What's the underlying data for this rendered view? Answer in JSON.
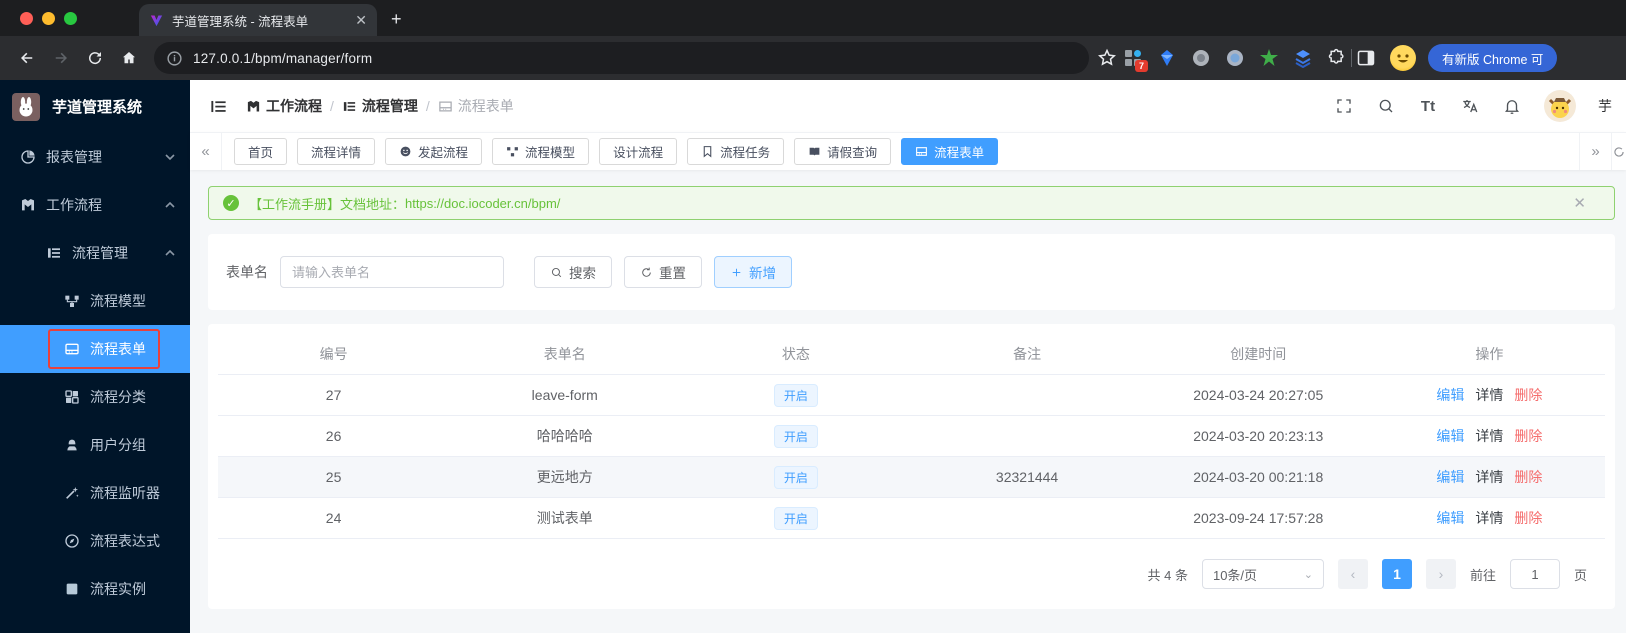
{
  "browser": {
    "tab_title": "芋道管理系统 - 流程表单",
    "url": "127.0.0.1/bpm/manager/form",
    "ext_badge": "7",
    "update_chip": "有新版 Chrome 可"
  },
  "sidebar": {
    "title": "芋道管理系统",
    "items": [
      {
        "label": "报表管理"
      },
      {
        "label": "工作流程"
      },
      {
        "label": "流程管理"
      },
      {
        "label": "流程模型"
      },
      {
        "label": "流程表单"
      },
      {
        "label": "流程分类"
      },
      {
        "label": "用户分组"
      },
      {
        "label": "流程监听器"
      },
      {
        "label": "流程表达式"
      },
      {
        "label": "流程实例"
      }
    ]
  },
  "header": {
    "breadcrumb": [
      {
        "label": "工作流程"
      },
      {
        "label": "流程管理"
      },
      {
        "label": "流程表单"
      }
    ],
    "font_btn": "Tt",
    "username": "芋"
  },
  "tagsbar": {
    "tabs": [
      {
        "label": "首页"
      },
      {
        "label": "流程详情"
      },
      {
        "label": "发起流程"
      },
      {
        "label": "流程模型"
      },
      {
        "label": "设计流程"
      },
      {
        "label": "流程任务"
      },
      {
        "label": "请假查询"
      },
      {
        "label": "流程表单"
      }
    ]
  },
  "alert": {
    "text": "【工作流手册】文档地址：",
    "link": "https://doc.iocoder.cn/bpm/"
  },
  "search": {
    "label": "表单名",
    "placeholder": "请输入表单名",
    "search_btn": "搜索",
    "reset_btn": "重置",
    "add_btn": "新增"
  },
  "table": {
    "headers": [
      "编号",
      "表单名",
      "状态",
      "备注",
      "创建时间",
      "操作"
    ],
    "actions": {
      "edit": "编辑",
      "detail": "详情",
      "delete": "删除"
    },
    "rows": [
      {
        "id": "27",
        "name": "leave-form",
        "status": "开启",
        "remark": "",
        "created": "2024-03-24 20:27:05"
      },
      {
        "id": "26",
        "name": "哈哈哈哈",
        "status": "开启",
        "remark": "",
        "created": "2024-03-20 20:23:13"
      },
      {
        "id": "25",
        "name": "更远地方",
        "status": "开启",
        "remark": "32321444",
        "created": "2024-03-20 00:21:18"
      },
      {
        "id": "24",
        "name": "测试表单",
        "status": "开启",
        "remark": "",
        "created": "2023-09-24 17:57:28"
      }
    ]
  },
  "pagination": {
    "total": "共 4 条",
    "page_size": "10条/页",
    "page": "1",
    "goto_label": "前往",
    "goto_value": "1",
    "unit": "页"
  },
  "colors": {
    "accent": "#409eff",
    "success": "#67c23a",
    "danger": "#f56c6c",
    "sidebar_bg": "#001529"
  }
}
